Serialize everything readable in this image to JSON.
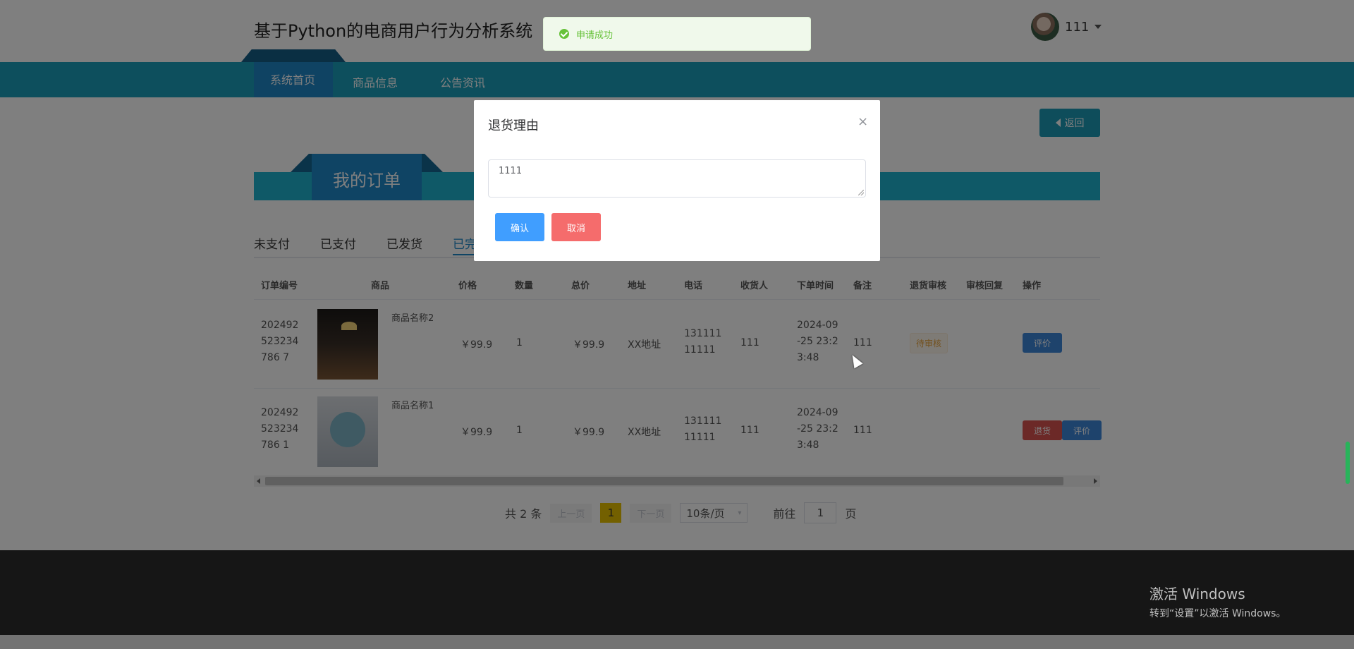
{
  "header": {
    "title": "基于Python的电商用户行为分析系统",
    "user_name": "111"
  },
  "nav": {
    "items": [
      "系统首页",
      "商品信息",
      "公告资讯"
    ]
  },
  "back_label": "返回",
  "section_title": "我的订单",
  "order_tabs": [
    "未支付",
    "已支付",
    "已发货",
    "已完"
  ],
  "table": {
    "headers": [
      "订单编号",
      "商品",
      "价格",
      "数量",
      "总价",
      "地址",
      "电话",
      "收货人",
      "下单时间",
      "备注",
      "退货审核",
      "审核回复",
      "操作"
    ],
    "rows": [
      {
        "order_no": "202492523234786 7",
        "product_name": "商品名称2",
        "price": "￥99.9",
        "qty": "1",
        "total": "￥99.9",
        "address": "XX地址",
        "phone": "13111111111",
        "receiver": "111",
        "time": "2024-09-25 23:23:48",
        "note": "111",
        "audit": "待审核",
        "reply": "",
        "actions": [
          "评价"
        ]
      },
      {
        "order_no": "202492523234786 1",
        "product_name": "商品名称1",
        "price": "￥99.9",
        "qty": "1",
        "total": "￥99.9",
        "address": "XX地址",
        "phone": "13111111111",
        "receiver": "111",
        "time": "2024-09-25 23:23:48",
        "note": "111",
        "audit": "",
        "reply": "",
        "actions": [
          "退货",
          "评价"
        ]
      }
    ]
  },
  "pager": {
    "total": "共 2 条",
    "prev": "上一页",
    "current": "1",
    "next": "下一页",
    "size": "10条/页",
    "goto_prefix": "前往",
    "goto_value": "1",
    "goto_suffix": "页"
  },
  "toast": {
    "message": "申请成功"
  },
  "dialog": {
    "title": "退货理由",
    "close": "×",
    "textarea_value": "1111",
    "confirm": "确认",
    "cancel": "取消"
  },
  "os_notice": {
    "line1": "激活 Windows",
    "line2": "转到“设置”以激活 Windows。"
  }
}
